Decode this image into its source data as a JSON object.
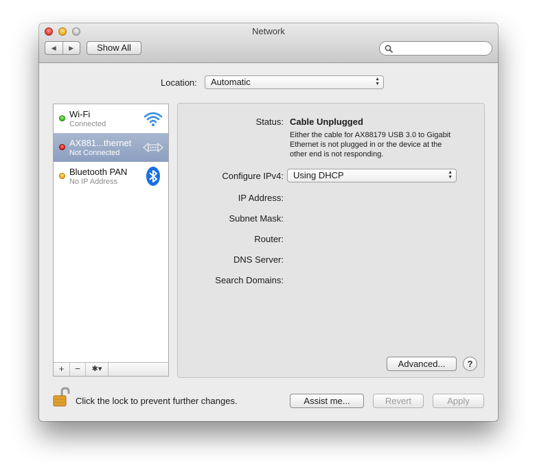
{
  "window": {
    "title": "Network"
  },
  "toolbar": {
    "back_glyph": "◀",
    "forward_glyph": "▶",
    "show_all_label": "Show All",
    "search_placeholder": ""
  },
  "location": {
    "label": "Location:",
    "value": "Automatic"
  },
  "services": [
    {
      "name": "Wi-Fi",
      "status": "Connected",
      "status_color": "#2fb414",
      "icon": "wifi-icon",
      "selected": false
    },
    {
      "name": "AX881...thernet",
      "status": "Not Connected",
      "status_color": "#d11a0e",
      "icon": "ethernet-icon",
      "selected": true
    },
    {
      "name": "Bluetooth PAN",
      "status": "No IP Address",
      "status_color": "#f0a810",
      "icon": "bluetooth-icon",
      "selected": false
    }
  ],
  "sidebar_toolbar": {
    "add": "+",
    "remove": "−",
    "action": "✱▾"
  },
  "detail": {
    "status_label": "Status:",
    "status_value": "Cable Unplugged",
    "status_description": "Either the cable for AX88179 USB 3.0 to Gigabit Ethernet is not plugged in or the device at the other end is not responding.",
    "configure_label": "Configure IPv4:",
    "configure_value": "Using DHCP",
    "ip_label": "IP Address:",
    "subnet_label": "Subnet Mask:",
    "router_label": "Router:",
    "dns_label": "DNS Server:",
    "search_domains_label": "Search Domains:",
    "advanced_label": "Advanced...",
    "help_label": "?"
  },
  "footer": {
    "lock_text": "Click the lock to prevent further changes.",
    "assist_label": "Assist me...",
    "revert_label": "Revert",
    "apply_label": "Apply"
  },
  "colors": {
    "selection": "#8c9ec0",
    "accent_bluetooth": "#1a6fe0",
    "wifi": "#3a8ee0"
  }
}
